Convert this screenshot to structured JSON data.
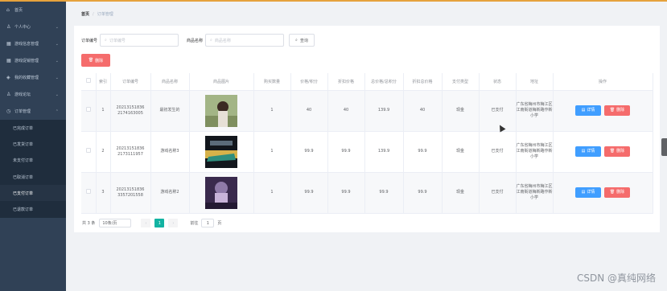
{
  "sidebar": {
    "items": [
      {
        "label": "首页",
        "icon": "home-icon",
        "chevron": ""
      },
      {
        "label": "个人中心",
        "icon": "user-icon",
        "chevron": "⌄"
      },
      {
        "label": "游戏信息管理",
        "icon": "grid-icon",
        "chevron": "⌄"
      },
      {
        "label": "游戏促销管理",
        "icon": "grid-icon",
        "chevron": "⌄"
      },
      {
        "label": "我的收藏管理",
        "icon": "shield-icon",
        "chevron": "⌄"
      },
      {
        "label": "游戏论坛",
        "icon": "user-icon",
        "chevron": "⌄"
      },
      {
        "label": "订单管理",
        "icon": "clock-icon",
        "chevron": "⌃"
      }
    ],
    "submenu": [
      "已完成订单",
      "已发货订单",
      "未支付订单",
      "已取消订单",
      "已支付订单",
      "已退款订单"
    ]
  },
  "breadcrumb": {
    "home": "首页",
    "sep": "/",
    "current": "订单管理"
  },
  "search": {
    "order_label": "订单编号",
    "order_placeholder": "订单编号",
    "product_label": "商品名称",
    "product_placeholder": "商品名称",
    "query_label": "查询"
  },
  "toolbar": {
    "delete_label": "删除"
  },
  "table": {
    "headers": [
      "",
      "索引",
      "订单编号",
      "商品名称",
      "商品图片",
      "购买数量",
      "价格/积分",
      "折扣价格",
      "总价格/总积分",
      "折扣总价格",
      "支付类型",
      "状态",
      "地址",
      "操作"
    ],
    "rows": [
      {
        "index": "1",
        "order_no": "20213151836 2174163005",
        "name": "最初发生的",
        "qty": "1",
        "price": "40",
        "discount": "40",
        "total": "139.9",
        "discount_total": "40",
        "pay": "现金",
        "status": "已支付",
        "address": "广东省梅州市梅江区江南街道梅新路作新小学"
      },
      {
        "index": "2",
        "order_no": "20213151836 2173111957",
        "name": "游戏名称3",
        "qty": "1",
        "price": "99.9",
        "discount": "99.9",
        "total": "139.9",
        "discount_total": "99.9",
        "pay": "现金",
        "status": "已支付",
        "address": "广东省梅州市梅江区江南街道梅新路作新小学"
      },
      {
        "index": "3",
        "order_no": "20213151836 3357201558",
        "name": "游戏名称2",
        "qty": "1",
        "price": "99.9",
        "discount": "99.9",
        "total": "99.9",
        "discount_total": "99.9",
        "pay": "现金",
        "status": "已支付",
        "address": "广东省梅州市梅江区江南街道梅新路作新小学"
      }
    ],
    "detail_label": "详情",
    "delete_label": "删除"
  },
  "pager": {
    "total": "共 3 条",
    "page_size": "10条/页",
    "prev": "‹",
    "current": "1",
    "next": "›",
    "goto_label": "前往",
    "goto_value": "1",
    "page_unit": "页"
  },
  "watermark": "CSDN @真纯网络",
  "colors": {
    "sidebar": "#304156",
    "accent": "#13b3a2",
    "danger": "#f56c6c",
    "primary": "#409eff",
    "topline": "#e6a23c"
  }
}
